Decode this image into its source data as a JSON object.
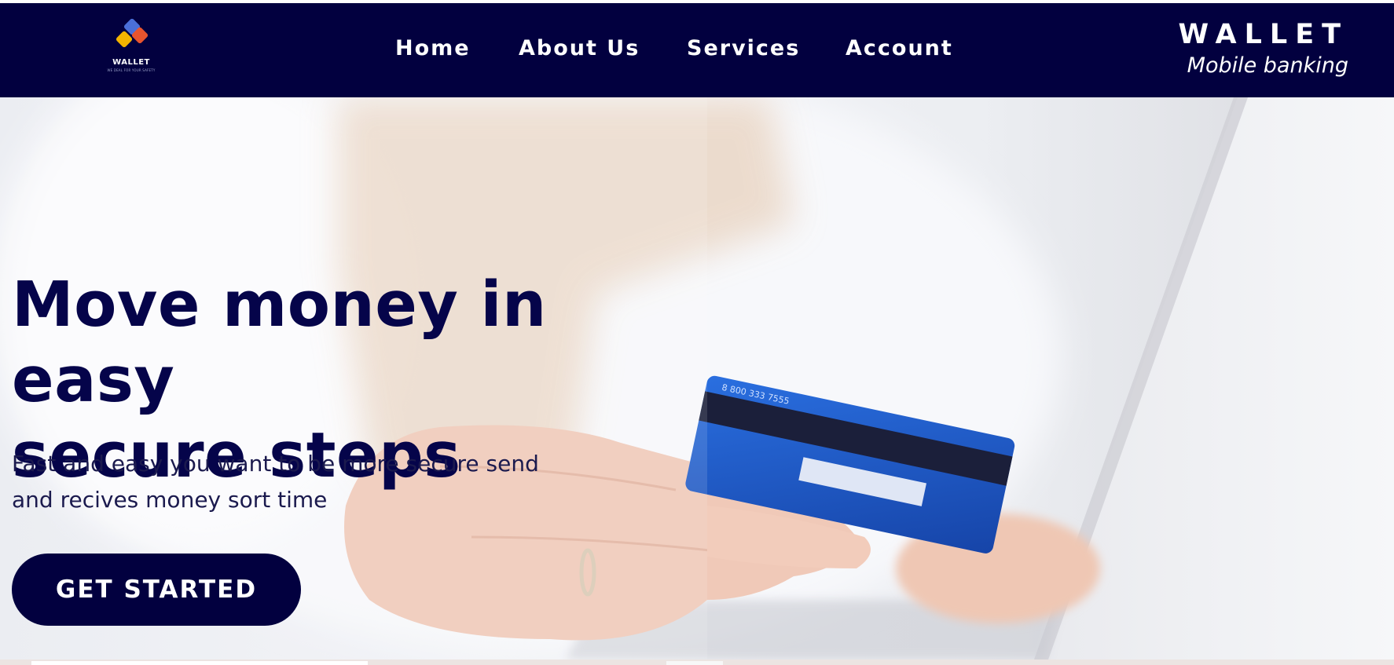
{
  "nav": {
    "logo_text": "WALLET",
    "logo_tagline": "WE DEAL FOR YOUR SAFETY",
    "links": [
      {
        "label": "Home"
      },
      {
        "label": "About Us"
      },
      {
        "label": "Services"
      },
      {
        "label": "Account"
      }
    ],
    "brand_title": "WALLET",
    "brand_subtitle": "Mobile banking"
  },
  "hero": {
    "headline_line1": "Move money in easy",
    "headline_line2": "secure steps",
    "subtext_line1": "Fast and easy you want to be more secure send",
    "subtext_line2": "and recives money sort time",
    "cta_label": "GET STARTED",
    "card_number": "8 800 333 7555",
    "image": "woman holding credit card at laptop"
  },
  "colors": {
    "navy": "#02003f",
    "headline": "#05044a",
    "card_blue": "#1f5fd0",
    "logo_blue": "#4a6fd8",
    "logo_orange": "#e8542e",
    "logo_yellow": "#f4b400"
  }
}
